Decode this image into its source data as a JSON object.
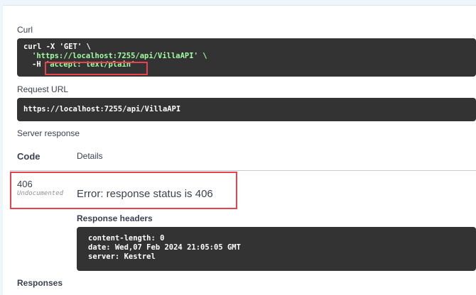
{
  "curl": {
    "label": "Curl",
    "line1": "curl -X 'GET' \\",
    "line2_url": "'https://localhost:7255/api/VillaAPI' \\",
    "line3_flag": "-H ",
    "line3_header": "'accept: text/plain'"
  },
  "request_url": {
    "label": "Request URL",
    "value": "https://localhost:7255/api/VillaAPI"
  },
  "server_response": {
    "label": "Server response",
    "col_code": "Code",
    "col_details": "Details",
    "status_code": "406",
    "status_note": "Undocumented",
    "error_message": "Error: response status is 406",
    "headers_label": "Response headers",
    "headers": [
      "content-length: 0",
      "date: Wed,07 Feb 2024 21:05:05 GMT",
      "server: Kestrel"
    ]
  },
  "responses": {
    "label": "Responses"
  },
  "colors": {
    "code_bg": "#333333",
    "string_green": "#a2fca2",
    "highlight_red": "#e8424f"
  }
}
